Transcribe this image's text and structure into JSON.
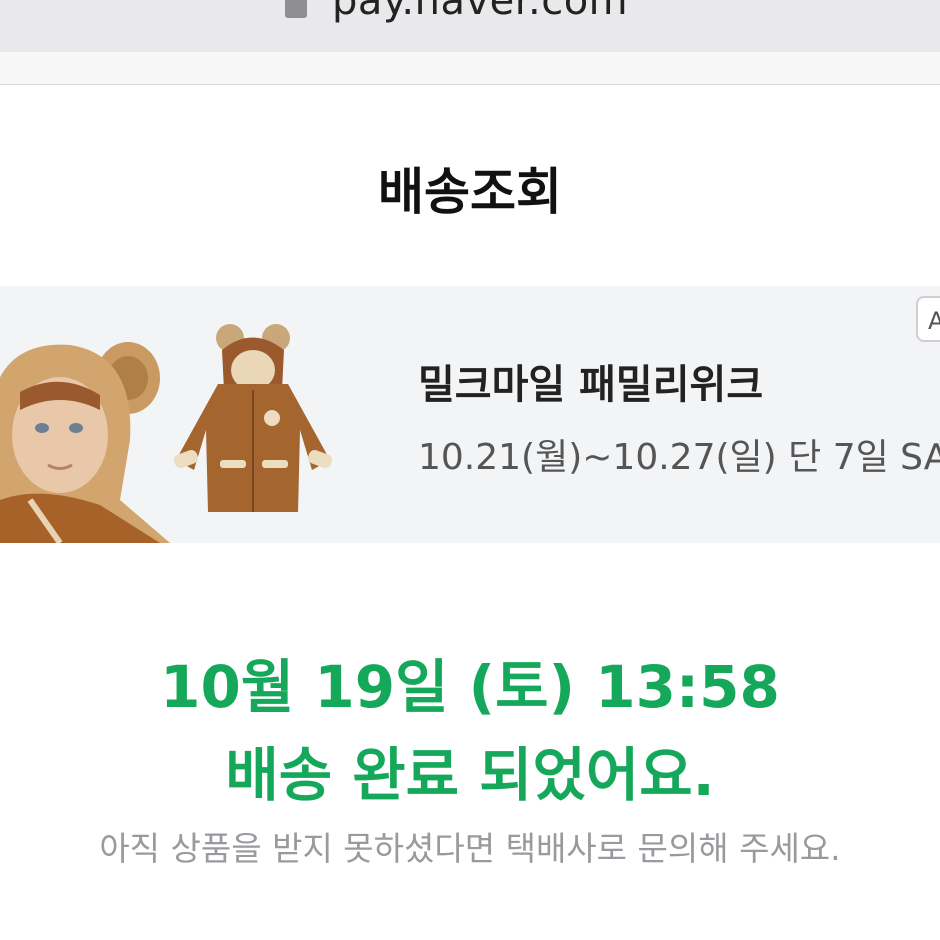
{
  "browser": {
    "url": "pay.naver.com"
  },
  "header": {
    "title": "배송조회"
  },
  "banner": {
    "badge": "A",
    "title": "밀크마일 패밀리위크",
    "subtitle": "10.21(월)~10.27(일) 단 7일 SA"
  },
  "status": {
    "datetime": "10월 19일 (토) 13:58",
    "message": "배송 완료 되었어요."
  },
  "notice": {
    "text": "아직 상품을 받지 못하셨다면 택배사로 문의해 주세요."
  },
  "colors": {
    "accent": "#16a85a",
    "banner_bg": "#f3f4f6"
  }
}
